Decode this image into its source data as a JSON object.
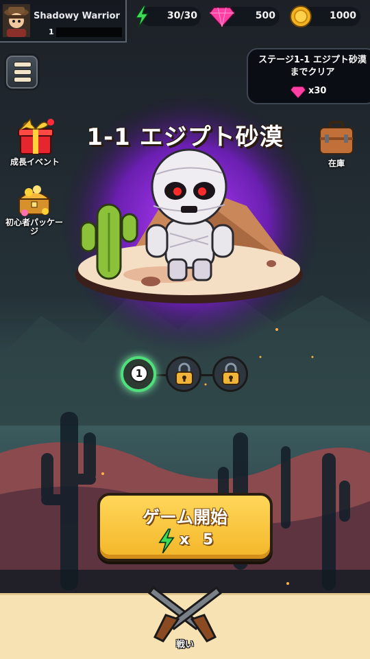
{
  "player": {
    "name": "Shadowy Warrior",
    "level": "1"
  },
  "resources": {
    "energy": "30/30",
    "gems": "500",
    "coins": "1000"
  },
  "quest": {
    "title": "ステージ1-1 エジプト砂漠までクリア",
    "reward": "x30"
  },
  "side_left": [
    {
      "label": "成長イベント"
    },
    {
      "label": "初心者パッケージ"
    }
  ],
  "inventory": {
    "label": "在庫"
  },
  "stage": {
    "title": "1-1 エジプト砂漠",
    "nodes": [
      {
        "label": "1",
        "state": "current"
      },
      {
        "label": "",
        "state": "locked"
      },
      {
        "label": "",
        "state": "locked"
      }
    ]
  },
  "start_button": {
    "label": "ゲーム開始",
    "cost": "x 5"
  },
  "nav": {
    "battle_label": "戦い"
  },
  "colors": {
    "accent": "#f3b628",
    "energy": "#3ddc57",
    "gem": "#ff3fa4",
    "coin": "#f4b21f"
  }
}
